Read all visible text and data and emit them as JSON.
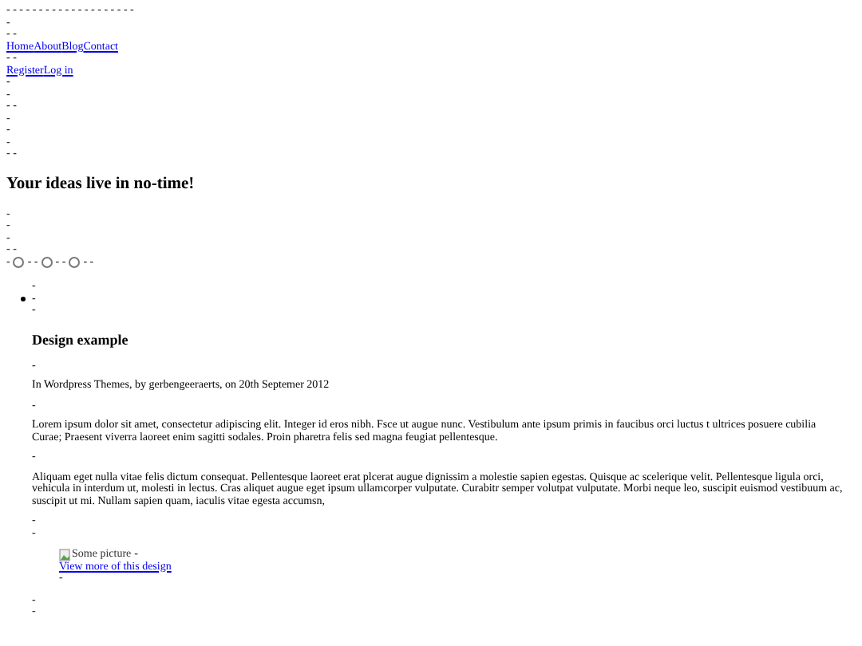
{
  "top_marks": [
    "- - - - - - - - - - - - - - - - - - - -",
    "-",
    "- -"
  ],
  "nav_links": [
    "Home",
    "About",
    "Blog",
    "Contact"
  ],
  "nav_mark": "- -",
  "auth_links": [
    "Register",
    "Log in"
  ],
  "header_marks": [
    "-",
    "-",
    "- -",
    "-",
    "-",
    "-",
    "- -"
  ],
  "tagline": "Your ideas live in no-time!",
  "slider_marks": [
    "-",
    "-",
    "-",
    "- -"
  ],
  "slider": {
    "lead": "-",
    "dots": [
      {
        "selected": false,
        "after": "- -"
      },
      {
        "selected": false,
        "after": "- -"
      },
      {
        "selected": false,
        "after": "- -"
      }
    ]
  },
  "list_marks": [
    "-"
  ],
  "post": {
    "bullet_mark": "-",
    "marks": [
      "-"
    ],
    "title": "Design example",
    "blocks": [
      {
        "kind": "mark",
        "text": "-"
      },
      {
        "kind": "para",
        "text": "In Wordpress Themes, by gerbengeeraerts, on 20th Septemer 2012"
      },
      {
        "kind": "mark",
        "text": "-"
      },
      {
        "kind": "para",
        "text": "Lorem ipsum dolor sit amet, consectetur adipiscing elit. Integer id eros nibh. Fsce ut augue nunc. Vestibulum ante ipsum primis in faucibus orci luctus t ultrices posuere cubilia Curae; Praesent viverra laoreet enim sagitti sodales. Proin pharetra felis sed magna feugiat pellentesque."
      },
      {
        "kind": "mark",
        "text": "-"
      },
      {
        "kind": "para",
        "text": "Aliquam eget nulla vitae felis dictum consequat. Pellentesque laoreet erat plcerat augue dignissim a molestie sapien egestas. Quisque ac scelerique velit. Pellentesque ligula orci, vehicula in interdum ut, molesti in lectus. Cras aliquet augue eget ipsum ullamcorper vulputate. Curabitr semper volutpat vulputate. Morbi neque leo, suscipit euismod vestibuum ac, suscipit ut mi. Nullam sapien quam, iaculis vitae egesta accumsn,"
      },
      {
        "kind": "line",
        "text": "-"
      },
      {
        "kind": "line",
        "text": "-"
      },
      {
        "kind": "figure",
        "alt": "Some picture",
        "after": "-",
        "link": "View more of this design",
        "mark": "-"
      },
      {
        "kind": "line",
        "text": "-"
      },
      {
        "kind": "line",
        "text": "-"
      }
    ]
  }
}
